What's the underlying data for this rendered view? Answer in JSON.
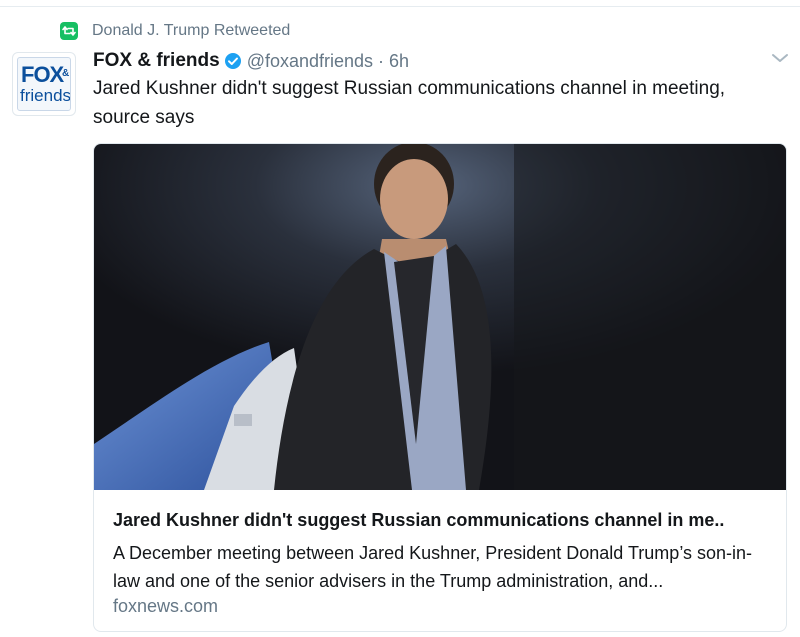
{
  "retweet": {
    "icon": "retweet-icon",
    "text": "Donald J. Trump Retweeted",
    "accent": "#17bf63"
  },
  "tweet": {
    "avatar": {
      "icon": "fox-and-friends-logo",
      "logo_word": "FOX",
      "logo_amp": "&",
      "logo_sub": "friends"
    },
    "display_name": "FOX & friends",
    "verified_icon": "verified-badge-icon",
    "handle": "@foxandfriends",
    "separator": "·",
    "time": "6h",
    "menu_icon": "chevron-down-icon",
    "text": "Jared Kushner didn't suggest Russian communications channel in meeting, source says"
  },
  "card": {
    "image_alt": "Jared Kushner at night beside an aircraft",
    "title": "Jared Kushner didn't suggest Russian communications channel in me..",
    "description": "A December meeting between Jared Kushner, President Donald Trump’s son-in-law and one of the senior advisers in the Trump administration, and...",
    "domain": "foxnews.com"
  },
  "colors": {
    "text": "#14171a",
    "muted": "#657786",
    "border": "#e1e8ed",
    "verified": "#1da1f2",
    "logo_blue": "#0b4f9c"
  }
}
